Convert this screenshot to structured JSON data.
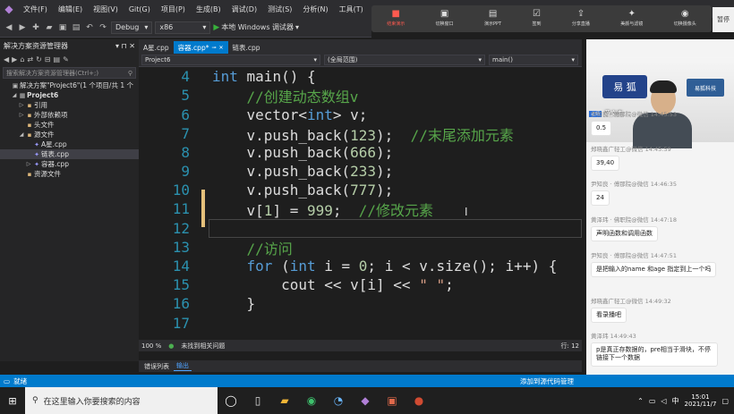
{
  "menu": {
    "items": [
      "文件(F)",
      "编辑(E)",
      "视图(V)",
      "Git(G)",
      "项目(P)",
      "生成(B)",
      "调试(D)",
      "测试(S)",
      "分析(N)",
      "工具(T)",
      "扩"
    ]
  },
  "toolbar": {
    "config": "Debug",
    "platform": "x86",
    "run_label": "本地 Windows 调试器"
  },
  "recorder": {
    "items": [
      {
        "label": "结束演示",
        "icon": "■"
      },
      {
        "label": "切换窗口",
        "icon": "▣"
      },
      {
        "label": "演示PPT",
        "icon": "▤"
      },
      {
        "label": "签到",
        "icon": "☑"
      },
      {
        "label": "分享直播",
        "icon": "⇪"
      },
      {
        "label": "美颜与滤镜",
        "icon": "✦"
      },
      {
        "label": "切换摄像头",
        "icon": "◉"
      }
    ],
    "pause_label": "暂停"
  },
  "solution": {
    "title": "解决方案资源管理器",
    "search_placeholder": "搜索解决方案资源管理器(Ctrl+;)",
    "tree": [
      {
        "label": "解决方案\"Project6\"(1 个项目/共 1 个",
        "indent": 0,
        "arrow": "",
        "icon": "▣"
      },
      {
        "label": "Project6",
        "indent": 1,
        "arrow": "◢",
        "icon": "▦",
        "bold": true
      },
      {
        "label": "引用",
        "indent": 2,
        "arrow": "▷",
        "icon": "▪"
      },
      {
        "label": "外部依赖项",
        "indent": 2,
        "arrow": "▷",
        "icon": "▪"
      },
      {
        "label": "头文件",
        "indent": 2,
        "arrow": "",
        "icon": "▪"
      },
      {
        "label": "源文件",
        "indent": 2,
        "arrow": "◢",
        "icon": "▪"
      },
      {
        "label": "A星.cpp",
        "indent": 3,
        "arrow": "",
        "icon": "✦"
      },
      {
        "label": "链表.cpp",
        "indent": 3,
        "arrow": "",
        "icon": "✦",
        "selected": true
      },
      {
        "label": "容器.cpp",
        "indent": 3,
        "arrow": "▷",
        "icon": "✦"
      },
      {
        "label": "资源文件",
        "indent": 2,
        "arrow": "",
        "icon": "▪"
      }
    ]
  },
  "editor": {
    "tabs": [
      {
        "label": "A星.cpp",
        "active": false
      },
      {
        "label": "容器.cpp*",
        "active": true
      },
      {
        "label": "链表.cpp",
        "active": false
      }
    ],
    "nav_project": "Project6",
    "nav_scope": "(全局范围)",
    "nav_func": "main()",
    "zoom": "100 %",
    "issues": "未找到相关问题",
    "row": "行: 12"
  },
  "output_tabs": [
    "错误列表",
    "输出"
  ],
  "status": {
    "text": "就绪",
    "right": "添加到源代码管理"
  },
  "chat": {
    "teacher_tag": "老师",
    "teacher_name": "黄文杰",
    "logo_text": "易 狐",
    "logo2_text": "易狐科技",
    "messages": [
      {
        "meta": "尹知良 · 傅那院@微信  14:45:53",
        "text": "0.5"
      },
      {
        "meta": "郑晓鑫广轻工@微信  14:45:59",
        "text": "39,40"
      },
      {
        "meta": "尹知良 · 傅那院@微信  14:46:35",
        "text": "24"
      },
      {
        "meta": "黄泽玮 · 佛职院@微信  14:47:18",
        "text": "声明函数和调用函数"
      },
      {
        "meta": "尹知良 · 傅那院@微信  14:47:51",
        "text": "是把输入的name 和age 指定到上一个吗"
      },
      {
        "meta": "郑晓鑫广轻工@微信  14:49:32",
        "text": "看录播吧"
      },
      {
        "meta": "黄泽玮  14:49:43",
        "text": "p是真正存数据的，pre相当于滑块，不停链接下一个数据"
      }
    ]
  },
  "taskbar": {
    "search_placeholder": "在这里输入你要搜索的内容",
    "time": "15:01",
    "date": "2021/11/7",
    "ime": "中"
  }
}
